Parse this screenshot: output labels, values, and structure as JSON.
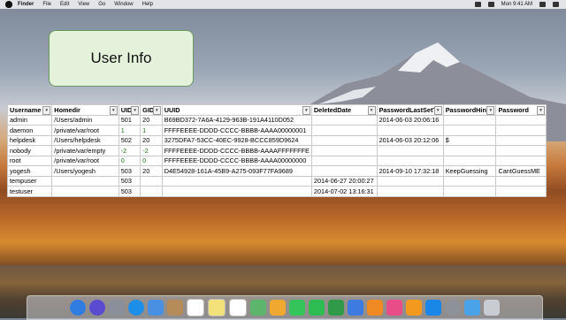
{
  "menubar": {
    "items": [
      "Finder",
      "File",
      "Edit",
      "View",
      "Go",
      "Window",
      "Help"
    ],
    "clock": "Mon 9:41 AM"
  },
  "panel": {
    "title": "User Info"
  },
  "table": {
    "columns": [
      "Username",
      "Homedir",
      "UID",
      "GID",
      "UUID",
      "DeletedDate",
      "PasswordLastSetT",
      "PasswordHint",
      "Password"
    ],
    "rows": [
      [
        "admin",
        "/Users/admin",
        "501",
        "20",
        "B69BD372-7A6A-4129-963B-191A4110D052",
        "",
        "2014-06-03 20:06:16",
        "",
        ""
      ],
      [
        "daemon",
        "/private/var/root",
        "1",
        "1",
        "FFFFEEEE-DDDD-CCCC-BBBB-AAAA00000001",
        "",
        "",
        "",
        ""
      ],
      [
        "helpdesk",
        "/Users/helpdesk",
        "502",
        "20",
        "3275DFA7-53CC-40EC-9928-BCCC859D9624",
        "",
        "2014-06-03 20:12:06",
        "$",
        ""
      ],
      [
        "nobody",
        "/private/var/empty",
        "-2",
        "-2",
        "FFFFEEEE-DDDD-CCCC-BBBB-AAAAFFFFFFFE",
        "",
        "",
        "",
        ""
      ],
      [
        "root",
        "/private/var/root",
        "0",
        "0",
        "FFFFEEEE-DDDD-CCCC-BBBB-AAAA00000000",
        "",
        "",
        "",
        ""
      ],
      [
        "yogesh",
        "/Users/yogesh",
        "503",
        "20",
        "D4E54928-161A-45B9-A275-093F77FA9689",
        "",
        "2014-09-10 17:32:18",
        "KeepGuessing",
        "CantGuessME"
      ],
      [
        "tempuser",
        "",
        "503",
        "",
        "",
        "2014-06-27 20:00:27",
        "",
        "",
        ""
      ],
      [
        "testuser",
        "",
        "503",
        "",
        "",
        "2014-07-02 13:16:31",
        "",
        "",
        ""
      ]
    ]
  },
  "dock": {
    "icons": [
      "finder-icon",
      "siri-icon",
      "launchpad-icon",
      "safari-icon",
      "mail-icon",
      "contacts-icon",
      "calendar-icon",
      "notes-icon",
      "reminders-icon",
      "maps-icon",
      "photos-icon",
      "messages-icon",
      "facetime-icon",
      "numbers-icon",
      "keynote-icon",
      "pages-icon",
      "itunes-icon",
      "ibooks-icon",
      "appstore-icon",
      "system-preferences-icon",
      "downloads-folder-icon",
      "trash-icon"
    ],
    "colors": [
      "#2f7de1",
      "#5a4bd1",
      "#8a8f99",
      "#1e8fe8",
      "#4a90e2",
      "#b58b5a",
      "#ffffff",
      "#f3e27a",
      "#ffffff",
      "#5bb56a",
      "#f0a830",
      "#35c45a",
      "#2ebd52",
      "#2f9b48",
      "#3d7be0",
      "#f08a24",
      "#e84d8a",
      "#f39a1e",
      "#1a86e8",
      "#8d9198",
      "#4aa3e8",
      "#c9ccd2"
    ]
  }
}
